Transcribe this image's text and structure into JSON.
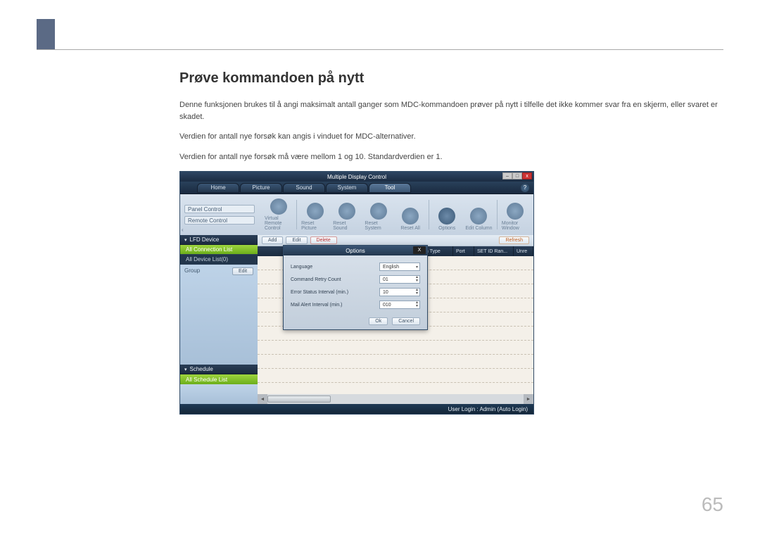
{
  "page": {
    "heading": "Prøve kommandoen på nytt",
    "para1": "Denne funksjonen brukes til å angi maksimalt antall ganger som MDC-kommandoen prøver på nytt i tilfelle det ikke kommer svar fra en skjerm, eller svaret er skadet.",
    "para2": "Verdien for antall nye forsøk kan angis i vinduet for MDC-alternativer.",
    "para3": "Verdien for antall nye forsøk må være mellom 1 og 10. Standardverdien er 1.",
    "number": "65"
  },
  "app": {
    "title": "Multiple Display Control",
    "tabs": {
      "home": "Home",
      "picture": "Picture",
      "sound": "Sound",
      "system": "System",
      "tool": "Tool"
    },
    "ribbon": {
      "panel_control": "Panel Control",
      "remote_control": "Remote Control",
      "virtual_remote": "Virtual Remote Control",
      "reset_picture": "Reset Picture",
      "reset_sound": "Reset Sound",
      "reset_system": "Reset System",
      "reset_all": "Reset All",
      "options": "Options",
      "edit_column": "Edit Column",
      "monitor_window": "Monitor Window"
    },
    "sidebar": {
      "lfd_device": "LFD Device",
      "all_connection_list": "All Connection List",
      "all_device_list": "All Device List(0)",
      "group": "Group",
      "edit": "Edit",
      "schedule": "Schedule",
      "all_schedule_list": "All Schedule List"
    },
    "toolbar": {
      "add": "Add",
      "edit": "Edit",
      "delete": "Delete",
      "refresh": "Refresh"
    },
    "columns": {
      "ction_type": "ction Type",
      "port": "Port",
      "setid_ran": "SET ID Ran...",
      "unre": "Unre"
    },
    "status": "User Login : Admin (Auto Login)",
    "help": "?"
  },
  "dialog": {
    "title": "Options",
    "fields": {
      "language_label": "Language",
      "language_value": "English",
      "retry_label": "Command Retry Count",
      "retry_value": "01",
      "error_label": "Error Status Interval (min.)",
      "error_value": "10",
      "mail_label": "Mail Alert Interval (min.)",
      "mail_value": "010"
    },
    "ok": "Ok",
    "cancel": "Cancel",
    "close": "X"
  }
}
